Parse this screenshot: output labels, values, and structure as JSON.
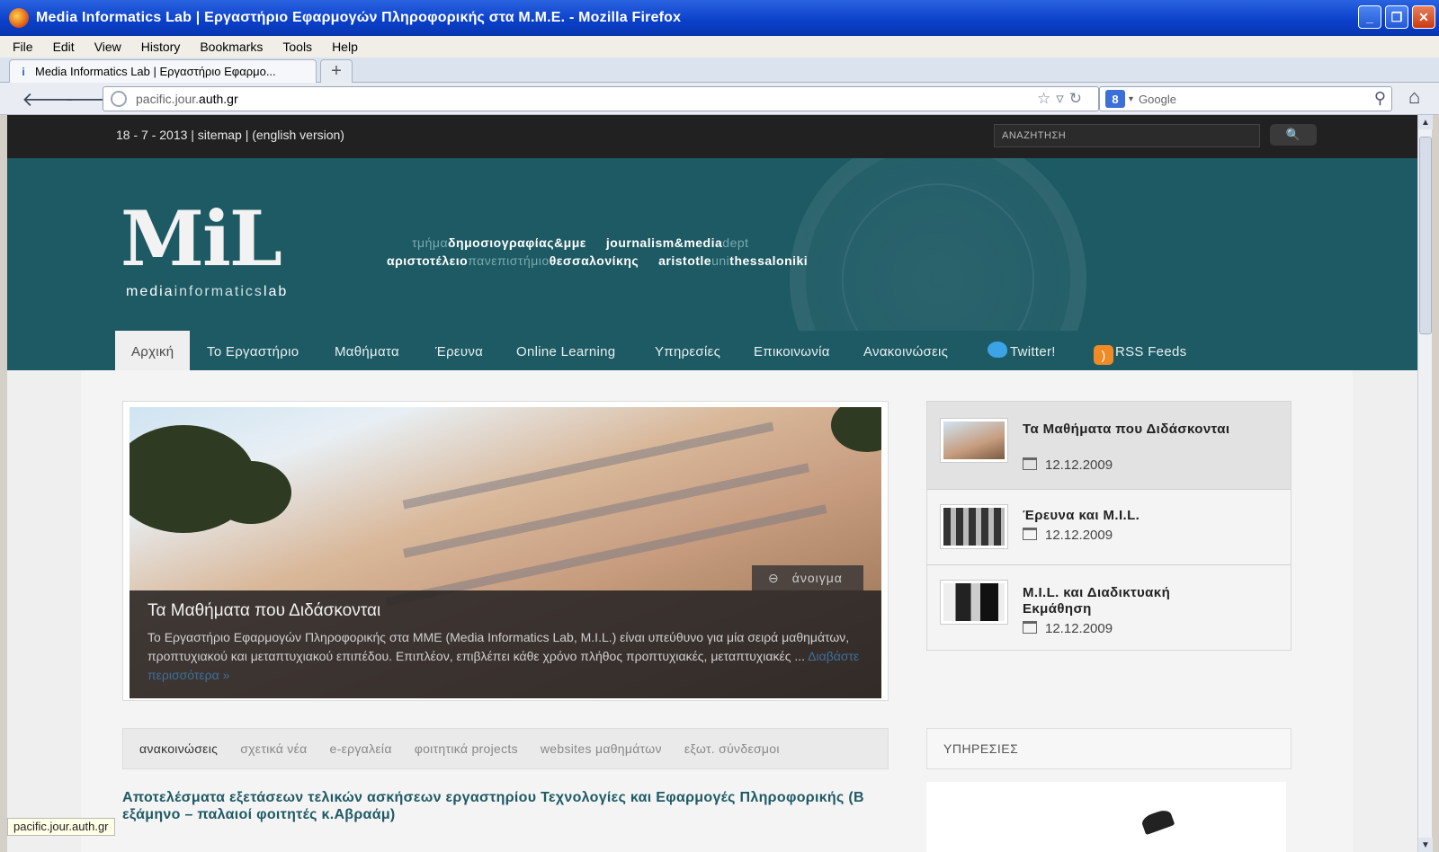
{
  "window": {
    "title": "Media Informatics Lab | Εργαστήριο Εφαρμογών Πληροφορικής στα Μ.Μ.Ε. - Mozilla Firefox",
    "buttons": {
      "minimize": "_",
      "restore": "❐",
      "close": "✕"
    }
  },
  "menu": [
    "File",
    "Edit",
    "View",
    "History",
    "Bookmarks",
    "Tools",
    "Help"
  ],
  "tab": {
    "label": "Media Informatics Lab | Εργαστήριο Εφαρμο...",
    "new_tab": "+"
  },
  "nav": {
    "url_prefix": "pacific.jour.",
    "url_domain": "auth.gr",
    "search_engine": "Google",
    "icons": [
      "back-arrow-icon",
      "forward-arrow-icon",
      "bookmark-star-icon",
      "reload-icon",
      "search-icon",
      "home-icon"
    ]
  },
  "site": {
    "topbar_text": "18 - 7 - 2013 | sitemap | (english version)",
    "search_placeholder": "ΑΝΑΖΗΤΗΣΗ",
    "logo": "MiL",
    "logo_sub_1": "media",
    "logo_sub_2": "informatics",
    "logo_sub_3": "lab",
    "dept_line1": [
      {
        "t": "τμήμα",
        "light": true
      },
      {
        "t": "δημοσιογραφίας&μμε",
        "light": false
      },
      {
        "t": "     journalism&media",
        "light": false
      },
      {
        "t": "dept",
        "light": true
      }
    ],
    "dept_line2": [
      {
        "t": "αριστοτέλειο",
        "light": false
      },
      {
        "t": "πανεπιστήμιο",
        "light": true
      },
      {
        "t": "θεσσαλονίκης",
        "light": false
      },
      {
        "t": "     aristotle",
        "light": false
      },
      {
        "t": "uni",
        "light": true
      },
      {
        "t": "thessaloniki",
        "light": false
      }
    ],
    "main_nav": [
      "Αρχική",
      "Το Εργαστήριο",
      "Μαθήματα",
      "Έρευνα",
      "Online Learning",
      "Υπηρεσίες",
      "Επικοινωνία",
      "Ανακοινώσεις",
      "Twitter!",
      "RSS Feeds"
    ],
    "slider": {
      "open_label": "άνοιγμα",
      "title": "Τα Μαθήματα που Διδάσκονται",
      "text": "Το Εργαστήριο Εφαρμογών Πληροφορικής στα ΜΜΕ (Media Informatics Lab, M.I.L.) είναι υπεύθυνο για μία σειρά μαθημάτων, προπτυχιακού και μεταπτυχιακού επιπέδου. Επιπλέον, επιβλέπει κάθε χρόνο πλήθος προπτυχιακές, μεταπτυχιακές ...",
      "more": "Διαβάστε περισσότερα »"
    },
    "side_items": [
      {
        "title": "Τα Μαθήματα που Διδάσκονται",
        "date": "12.12.2009"
      },
      {
        "title": "Έρευνα και M.I.L.",
        "date": "12.12.2009"
      },
      {
        "title": "M.I.L. και Διαδικτυακή Εκμάθηση",
        "date": "12.12.2009"
      }
    ],
    "content_tabs": [
      "ανακοινώσεις",
      "σχετικά νέα",
      "e-εργαλεία",
      "φοιτητικά projects",
      "websites μαθημάτων",
      "εξωτ. σύνδεσμοι"
    ],
    "services_heading": "ΥΠΗΡΕΣΙΕΣ",
    "news_title": "Αποτελέσματα εξετάσεων τελικών ασκήσεων εργαστηρίου Τεχνολογίες και Εφαρμογές Πληροφορικής (Β εξάμηνο – παλαιοί φοιτητές κ.Αβραάμ)"
  },
  "status_bar": "pacific.jour.auth.gr"
}
